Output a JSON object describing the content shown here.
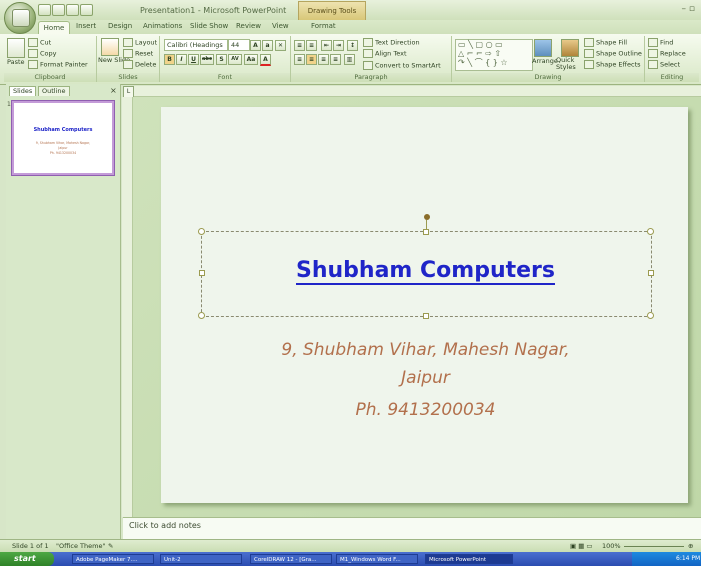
{
  "window": {
    "title": "Presentation1 - Microsoft PowerPoint",
    "contextual_tab": "Drawing Tools",
    "controls": "–  ▫"
  },
  "tabs": [
    "Home",
    "Insert",
    "Design",
    "Animations",
    "Slide Show",
    "Review",
    "View",
    "Format"
  ],
  "ribbon": {
    "clipboard": {
      "label": "Clipboard",
      "paste": "Paste",
      "cut": "Cut",
      "copy": "Copy",
      "format_painter": "Format Painter"
    },
    "slides": {
      "label": "Slides",
      "new_slide": "New Slide",
      "layout": "Layout",
      "reset": "Reset",
      "delete": "Delete"
    },
    "font": {
      "label": "Font",
      "family": "Calibri (Headings",
      "size": "44",
      "bold": "B",
      "italic": "I",
      "underline": "U",
      "strike": "abc",
      "shadow": "S",
      "spacing": "AV",
      "case": "Aa",
      "color": "A"
    },
    "paragraph": {
      "label": "Paragraph",
      "text_direction": "Text Direction",
      "align_text": "Align Text",
      "convert_smartart": "Convert to SmartArt"
    },
    "drawing": {
      "label": "Drawing",
      "arrange": "Arrange",
      "quick_styles": "Quick Styles",
      "shape_fill": "Shape Fill",
      "shape_outline": "Shape Outline",
      "shape_effects": "Shape Effects"
    },
    "editing": {
      "label": "Editing",
      "find": "Find",
      "replace": "Replace",
      "select": "Select"
    }
  },
  "panel": {
    "tab_slides": "Slides",
    "tab_outline": "Outline",
    "close": "×",
    "slide_number": "1"
  },
  "thumbnail": {
    "title": "Shubham Computers",
    "line1": "9, Shubham Vihar, Mahesh Nagar,",
    "line2": "Jaipur",
    "line3": "Ph. 9413200034"
  },
  "slide": {
    "title": "Shubham Computers",
    "address1": "9, Shubham Vihar, Mahesh Nagar,",
    "address2": "Jaipur",
    "phone": "Ph. 9413200034"
  },
  "notes_placeholder": "Click to add notes",
  "status": {
    "slide": "Slide 1 of 1",
    "theme": "\"Office Theme\"",
    "zoom": "100%"
  },
  "taskbar": {
    "start": "start",
    "tasks": [
      "Adobe PageMaker 7....",
      "Unit-2",
      "CorelDRAW 12 - [Gra...",
      "M1_Windows Word F...",
      "Microsoft PowerPoint"
    ],
    "clock": "6:14 PM"
  },
  "colors": {
    "title": "#1f25c8",
    "address": "#b2704c",
    "slide_bg": "#eff5ec"
  }
}
